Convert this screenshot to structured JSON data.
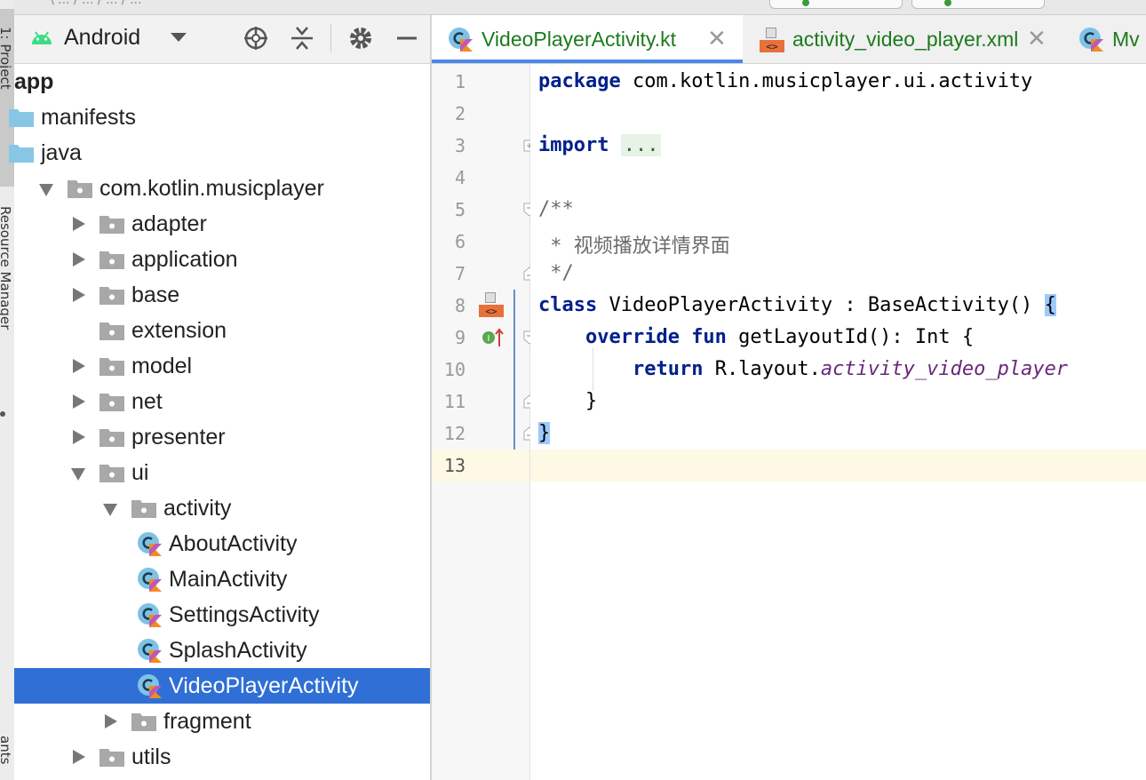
{
  "side_strip": {
    "tab_project": "1: Project",
    "tab_resource_manager": "Resource Manager",
    "tab_bottom": "ants"
  },
  "top_bar": {
    "crumbs": "\\ ... / ... / ... / ..."
  },
  "project_panel": {
    "view_mode": "Android",
    "tree": [
      {
        "label": "app",
        "depth": 0,
        "kind": "module",
        "arrow": "none"
      },
      {
        "label": "manifests",
        "depth": 1,
        "kind": "folder",
        "arrow": "none"
      },
      {
        "label": "java",
        "depth": 1,
        "kind": "folder",
        "arrow": "none"
      },
      {
        "label": "com.kotlin.musicplayer",
        "depth": 2,
        "kind": "package",
        "arrow": "down"
      },
      {
        "label": "adapter",
        "depth": 3,
        "kind": "package",
        "arrow": "right"
      },
      {
        "label": "application",
        "depth": 3,
        "kind": "package",
        "arrow": "right"
      },
      {
        "label": "base",
        "depth": 3,
        "kind": "package",
        "arrow": "right"
      },
      {
        "label": "extension",
        "depth": 3,
        "kind": "package",
        "arrow": "none"
      },
      {
        "label": "model",
        "depth": 3,
        "kind": "package",
        "arrow": "right"
      },
      {
        "label": "net",
        "depth": 3,
        "kind": "package",
        "arrow": "right"
      },
      {
        "label": "presenter",
        "depth": 3,
        "kind": "package",
        "arrow": "right"
      },
      {
        "label": "ui",
        "depth": 3,
        "kind": "package",
        "arrow": "down"
      },
      {
        "label": "activity",
        "depth": 4,
        "kind": "package",
        "arrow": "down"
      },
      {
        "label": "AboutActivity",
        "depth": 5,
        "kind": "kotlin-class",
        "arrow": "none"
      },
      {
        "label": "MainActivity",
        "depth": 5,
        "kind": "kotlin-class",
        "arrow": "none"
      },
      {
        "label": "SettingsActivity",
        "depth": 5,
        "kind": "kotlin-class",
        "arrow": "none"
      },
      {
        "label": "SplashActivity",
        "depth": 5,
        "kind": "kotlin-class",
        "arrow": "none"
      },
      {
        "label": "VideoPlayerActivity",
        "depth": 5,
        "kind": "kotlin-class",
        "arrow": "none",
        "selected": true
      },
      {
        "label": "fragment",
        "depth": 4,
        "kind": "package",
        "arrow": "right"
      },
      {
        "label": "utils",
        "depth": 3,
        "kind": "package",
        "arrow": "right"
      }
    ]
  },
  "editor": {
    "tabs": [
      {
        "label": "VideoPlayerActivity.kt",
        "icon": "kotlin-class-icon",
        "active": true,
        "closable": true
      },
      {
        "label": "activity_video_player.xml",
        "icon": "xml-layout-icon",
        "active": false,
        "closable": true
      },
      {
        "label": "Mv",
        "icon": "kotlin-class-icon",
        "active": false,
        "closable": false
      }
    ],
    "close_glyph": "✕",
    "lines": [
      {
        "n": "1",
        "tokens": [
          [
            "kw",
            "package"
          ],
          [
            "plain",
            " com.kotlin.musicplayer.ui.activity"
          ]
        ]
      },
      {
        "n": "2",
        "tokens": []
      },
      {
        "n": "3",
        "tokens": [
          [
            "kw",
            "import"
          ],
          [
            "plain",
            " "
          ],
          [
            "folded",
            "..."
          ]
        ]
      },
      {
        "n": "4",
        "tokens": []
      },
      {
        "n": "5",
        "tokens": [
          [
            "comment",
            "/**"
          ]
        ]
      },
      {
        "n": "6",
        "tokens": [
          [
            "comment",
            " * 视频播放详情界面"
          ]
        ]
      },
      {
        "n": "7",
        "tokens": [
          [
            "comment",
            " */"
          ]
        ]
      },
      {
        "n": "8",
        "tokens": [
          [
            "kw",
            "class"
          ],
          [
            "plain",
            " VideoPlayerActivity : BaseActivity() "
          ],
          [
            "brace-hl",
            "{"
          ]
        ]
      },
      {
        "n": "9",
        "tokens": [
          [
            "plain",
            "    "
          ],
          [
            "kw",
            "override fun"
          ],
          [
            "plain",
            " getLayoutId(): Int {"
          ]
        ]
      },
      {
        "n": "10",
        "tokens": [
          [
            "plain",
            "        "
          ],
          [
            "kw",
            "return"
          ],
          [
            "plain",
            " R.layout."
          ],
          [
            "italic-ref",
            "activity_video_player"
          ]
        ]
      },
      {
        "n": "11",
        "tokens": [
          [
            "plain",
            "    }"
          ]
        ]
      },
      {
        "n": "12",
        "tokens": [
          [
            "brace-hl",
            "}"
          ]
        ]
      },
      {
        "n": "13",
        "tokens": []
      }
    ],
    "current_line": "13"
  },
  "colors": {
    "keyword": "#00208a",
    "selection": "#2f6fd6",
    "tab_text": "#1d7a1d",
    "current_line_bg": "#fdf9e4",
    "brace_match": "#9dc9ff"
  }
}
